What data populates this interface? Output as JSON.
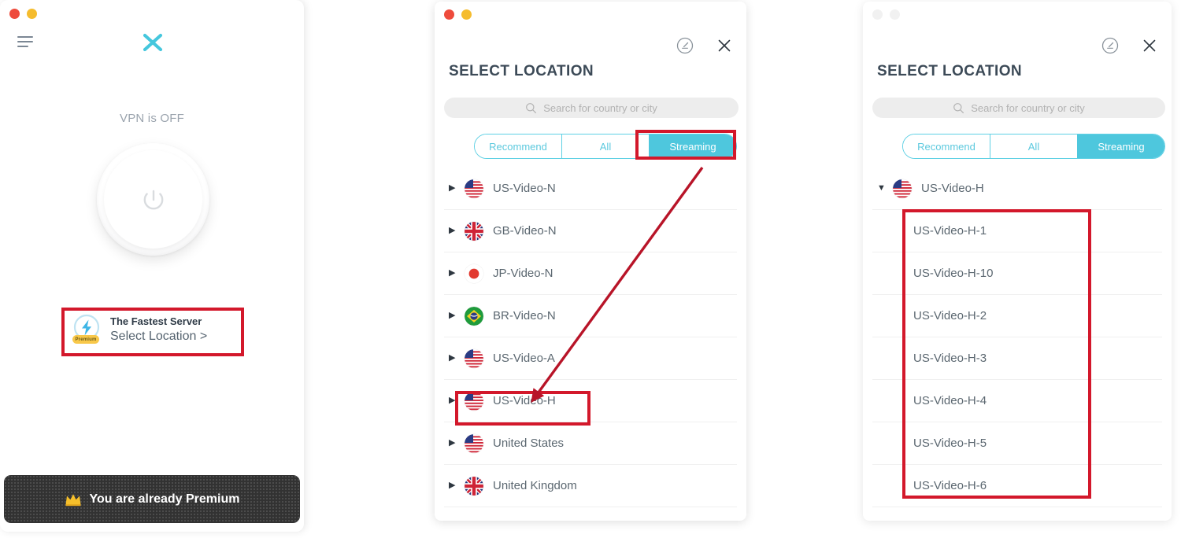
{
  "app": {
    "main_window": {
      "logo_icon": "x-logo-icon",
      "menu_icon": "hamburger-menu-icon",
      "status_text": "VPN is OFF",
      "power_icon": "power-button-icon",
      "fastest_server": {
        "bolt_icon": "lightning-bolt-icon",
        "premium_badge": "Premium",
        "title": "The Fastest Server",
        "subtitle": "Select Location >"
      },
      "premium_banner": {
        "crown_icon": "crown-icon",
        "text": "You are already Premium"
      },
      "traffic_lights": [
        "red",
        "yellow"
      ]
    },
    "location_window": {
      "title": "SELECT LOCATION",
      "speed_icon": "speedometer-icon",
      "close_icon": "close-icon",
      "search": {
        "icon": "search-icon",
        "placeholder": "Search for country or city",
        "value": ""
      },
      "tabs": [
        {
          "label": "Recommend",
          "active": false
        },
        {
          "label": "All",
          "active": false
        },
        {
          "label": "Streaming",
          "active": true
        }
      ],
      "list_collapsed": [
        {
          "caret": "collapsed",
          "flag": "us-flag-icon",
          "name": "US-Video-N"
        },
        {
          "caret": "collapsed",
          "flag": "gb-flag-icon",
          "name": "GB-Video-N"
        },
        {
          "caret": "collapsed",
          "flag": "jp-flag-icon",
          "name": "JP-Video-N"
        },
        {
          "caret": "collapsed",
          "flag": "br-flag-icon",
          "name": "BR-Video-N"
        },
        {
          "caret": "collapsed",
          "flag": "us-flag-icon",
          "name": "US-Video-A"
        },
        {
          "caret": "collapsed",
          "flag": "us-flag-icon",
          "name": "US-Video-H"
        },
        {
          "caret": "collapsed",
          "flag": "us-flag-icon",
          "name": "United States"
        },
        {
          "caret": "collapsed",
          "flag": "gb-flag-icon",
          "name": "United Kingdom"
        }
      ],
      "list_expanded_parent": {
        "caret": "expanded",
        "flag": "us-flag-icon",
        "name": "US-Video-H"
      },
      "list_expanded_children": [
        "US-Video-H-1",
        "US-Video-H-10",
        "US-Video-H-2",
        "US-Video-H-3",
        "US-Video-H-4",
        "US-Video-H-5",
        "US-Video-H-6"
      ]
    }
  },
  "annotations": {
    "color": "#d3182b",
    "boxes": [
      "fastest-server-card",
      "streaming-tab",
      "us-video-h-row",
      "us-video-h-sublist"
    ],
    "arrow": "streaming-tab-to-us-video-h"
  },
  "colors": {
    "accent_cyan": "#4ec7dd",
    "tab_border": "#5fd0e4",
    "annotation_red": "#d3182b",
    "banner_dark": "#323232",
    "premium_gold": "#f8c84a",
    "text_primary": "#3c4a57",
    "text_secondary": "#5b6770",
    "text_muted": "#9aa3ad"
  }
}
